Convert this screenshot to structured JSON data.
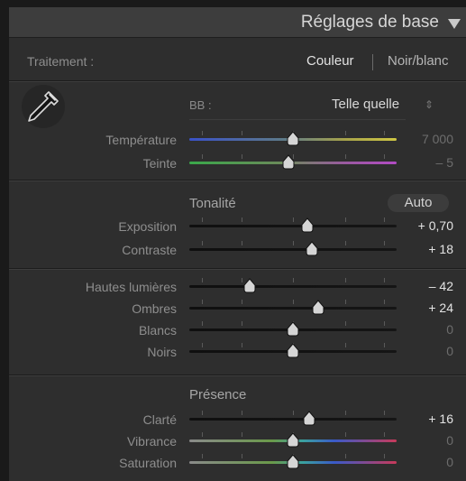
{
  "header": {
    "title": "Réglages de base"
  },
  "traitement": {
    "label": "Traitement :",
    "color_option": "Couleur",
    "bw_option": "Noir/blanc"
  },
  "wb": {
    "label": "BB :",
    "value": "Telle quelle",
    "stepper_glyph": "⇕"
  },
  "sliders_wb": [
    {
      "label": "Température",
      "value": "7 000",
      "fraction": 0.5,
      "value_active": false,
      "track": "temperature"
    },
    {
      "label": "Teinte",
      "value": "– 5",
      "fraction": 0.48,
      "value_active": false,
      "track": "tint"
    }
  ],
  "tonalite": {
    "title": "Tonalité",
    "auto_label": "Auto",
    "sliders": [
      {
        "label": "Exposition",
        "value": "+ 0,70",
        "fraction": 0.57,
        "value_active": true,
        "track": "dark"
      },
      {
        "label": "Contraste",
        "value": "+ 18",
        "fraction": 0.59,
        "value_active": true,
        "track": "dark"
      }
    ],
    "sliders2": [
      {
        "label": "Hautes lumières",
        "value": "– 42",
        "fraction": 0.29,
        "value_active": true,
        "track": "dark"
      },
      {
        "label": "Ombres",
        "value": "+ 24",
        "fraction": 0.62,
        "value_active": true,
        "track": "dark"
      },
      {
        "label": "Blancs",
        "value": "0",
        "fraction": 0.5,
        "value_active": false,
        "track": "dark"
      },
      {
        "label": "Noirs",
        "value": "0",
        "fraction": 0.5,
        "value_active": false,
        "track": "dark"
      }
    ]
  },
  "presence": {
    "title": "Présence",
    "sliders": [
      {
        "label": "Clarté",
        "value": "+ 16",
        "fraction": 0.58,
        "value_active": true,
        "track": "dark"
      },
      {
        "label": "Vibrance",
        "value": "0",
        "fraction": 0.5,
        "value_active": false,
        "track": "spectrum"
      },
      {
        "label": "Saturation",
        "value": "0",
        "fraction": 0.5,
        "value_active": false,
        "track": "spectrum"
      }
    ]
  },
  "colors": {
    "panel_bg": "#2e2e2e",
    "header_bg": "#3d3d3d",
    "active_text": "#e4e4e4",
    "dim_text": "#6d6d6d"
  },
  "icons": {
    "eyedropper": "eyedropper-icon",
    "collapse": "triangle-down-icon"
  }
}
